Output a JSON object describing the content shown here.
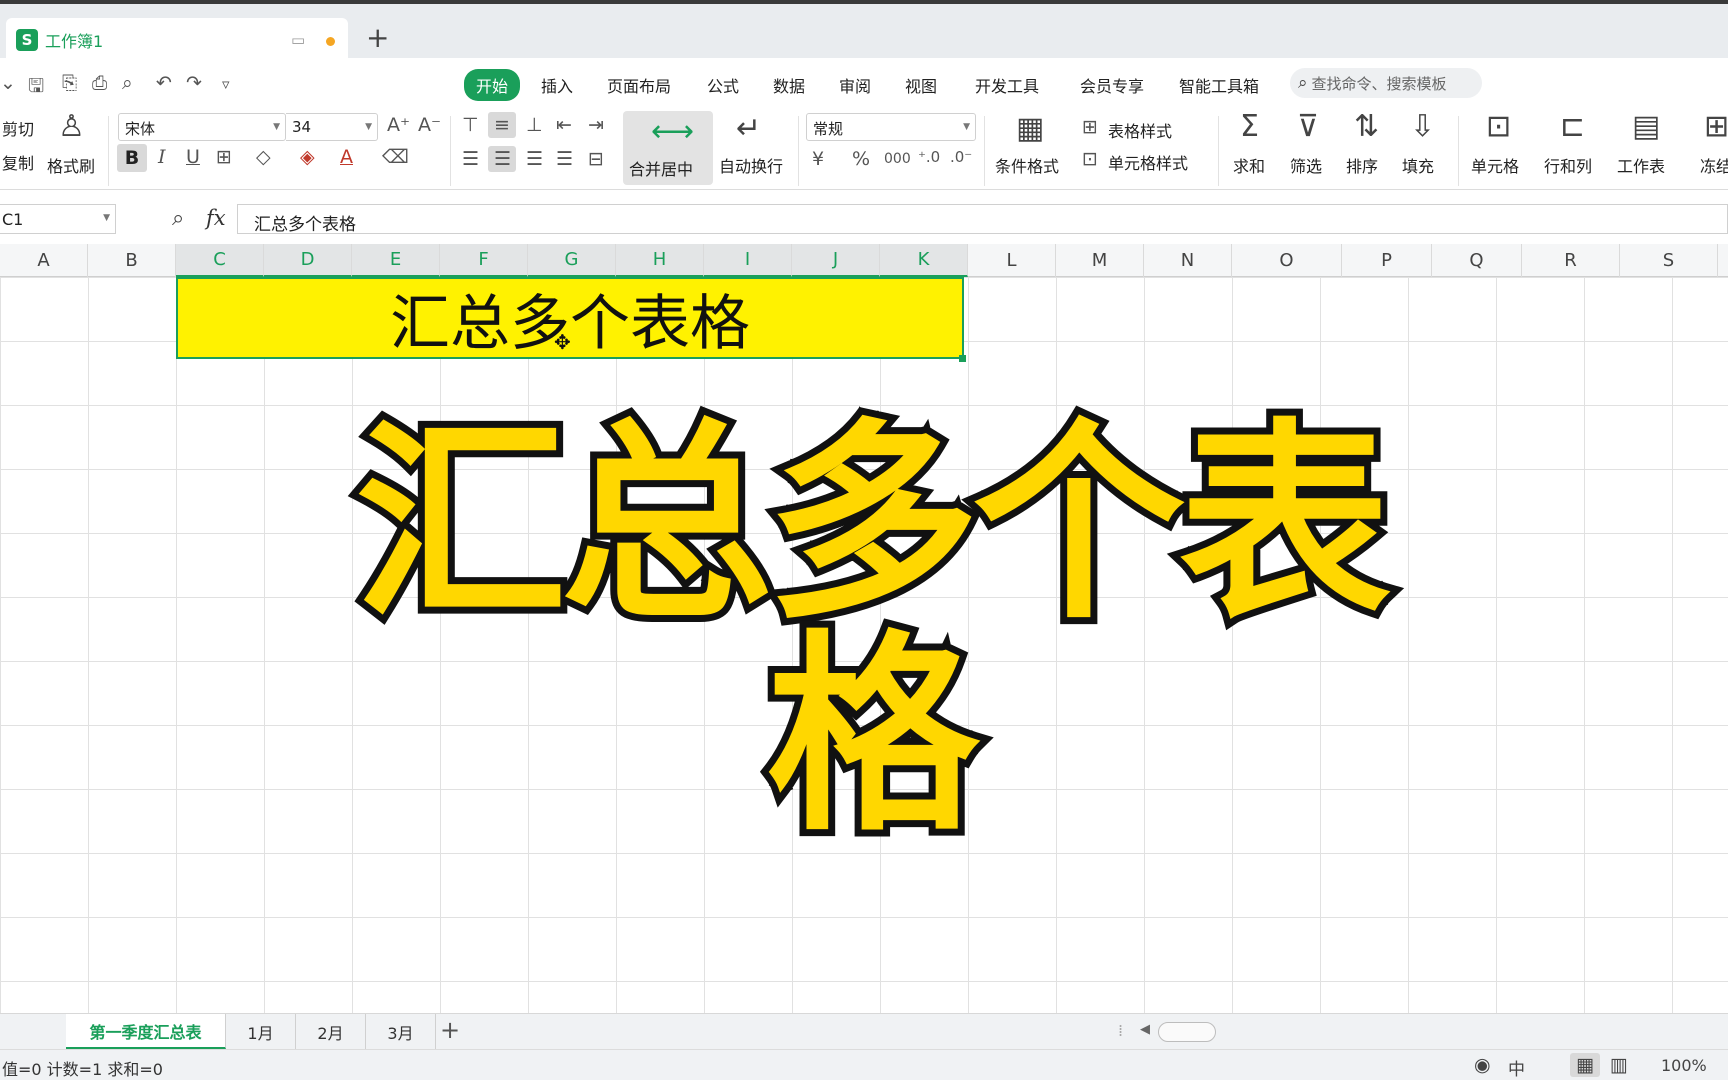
{
  "window": {
    "doc_title": "工作簿1"
  },
  "quick_access": [
    "save-icon",
    "format-painter-icon",
    "print-icon",
    "print-preview-icon",
    "undo-icon",
    "redo-icon",
    "customize-icon"
  ],
  "menu": {
    "tabs": [
      "开始",
      "插入",
      "页面布局",
      "公式",
      "数据",
      "审阅",
      "视图",
      "开发工具",
      "会员专享",
      "智能工具箱"
    ],
    "search_placeholder": "查找命令、搜索模板"
  },
  "ribbon": {
    "cut": "剪切",
    "copy": "复制",
    "format_painter": "格式刷",
    "font_name": "宋体",
    "font_size": "34",
    "bold": "B",
    "italic": "I",
    "underline": "U",
    "merge_center": "合并居中",
    "wrap_text": "自动换行",
    "number_format": "常规",
    "currency": "¥",
    "percent": "%",
    "thousands": "000",
    "cond_format": "条件格式",
    "table_style": "表格样式",
    "cell_style": "单元格样式",
    "sum": "求和",
    "filter": "筛选",
    "sort": "排序",
    "fill": "填充",
    "cells": "单元格",
    "rows_cols": "行和列",
    "worksheet": "工作表",
    "freeze": "冻结"
  },
  "formula_bar": {
    "name_box": "C1",
    "fx": "fx",
    "value": "汇总多个表格"
  },
  "columns": [
    "A",
    "B",
    "C",
    "D",
    "E",
    "F",
    "G",
    "H",
    "I",
    "J",
    "K",
    "L",
    "M",
    "N",
    "O",
    "P",
    "Q",
    "R",
    "S"
  ],
  "selected_columns": [
    "C",
    "D",
    "E",
    "F",
    "G",
    "H",
    "I",
    "J",
    "K"
  ],
  "cell_c1": "汇总多个表格",
  "overlay_title": "汇总多个表格",
  "sheets": {
    "tabs": [
      "第一季度汇总表",
      "1月",
      "2月",
      "3月"
    ],
    "active": "第一季度汇总表"
  },
  "status": {
    "summary": "值=0  计数=1  求和=0",
    "ime": "中",
    "zoom": "100%"
  },
  "colors": {
    "accent": "#1a9f5a",
    "cell_fill": "#fff200",
    "overlay_fill": "#ffd700"
  }
}
